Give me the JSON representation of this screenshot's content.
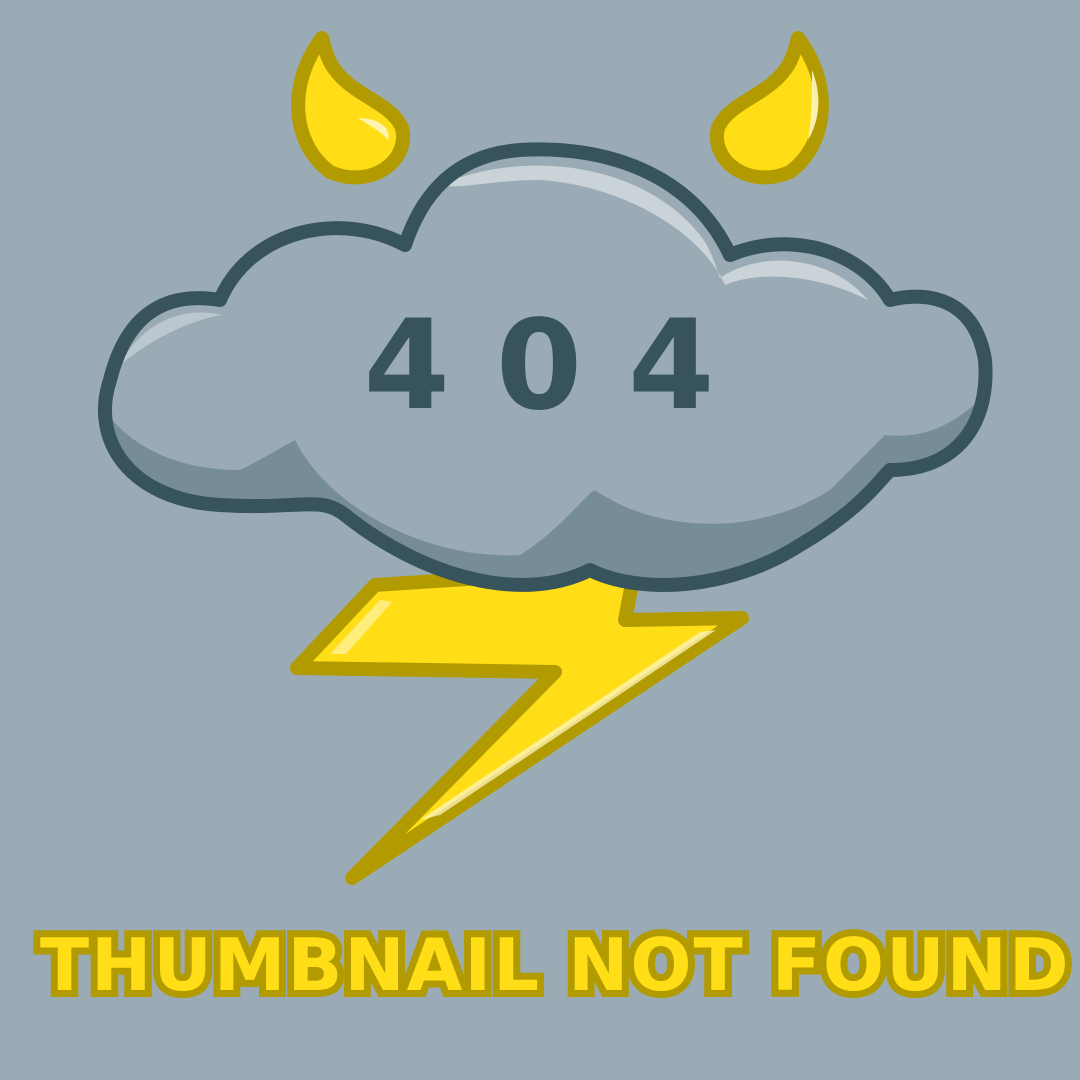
{
  "error_code": "404",
  "message": "THUMBNAIL NOT FOUND",
  "colors": {
    "background": "#9aabb5",
    "cloud_fill": "#9aabb5",
    "cloud_shadow": "#768d98",
    "cloud_highlight": "#c9d3d8",
    "cloud_outline": "#37535b",
    "code_text": "#37535b",
    "yellow_fill": "#ffde17",
    "yellow_outline": "#b29b00",
    "yellow_highlight": "#fff6c0"
  },
  "icons": [
    "devil-horn-icon",
    "storm-cloud-icon",
    "lightning-bolt-icon"
  ]
}
